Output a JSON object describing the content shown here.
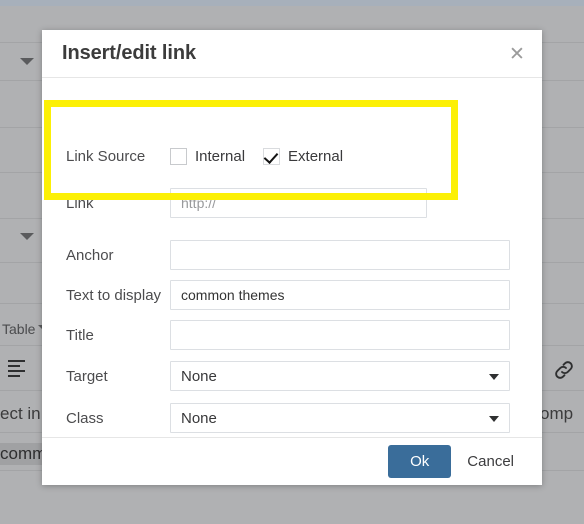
{
  "background": {
    "toolbar_items": [
      {
        "label": "Table",
        "icon": "caret-down-icon"
      }
    ],
    "align_icon": "align-left-icon",
    "link_icon": "link-icon",
    "content_text_left": "ect in",
    "content_text_right": "omp",
    "content_highlighted": "comm",
    "caret_icon": "caret-down-icon"
  },
  "modal": {
    "title": "Insert/edit link",
    "close_icon": "close-icon",
    "highlight_color": "#fcf005",
    "accent_color": "#3a6d9a",
    "fields": {
      "link_source": {
        "label": "Link Source",
        "options": [
          {
            "label": "Internal",
            "checked": false
          },
          {
            "label": "External",
            "checked": true
          }
        ]
      },
      "link": {
        "label": "Link",
        "value": "",
        "placeholder": "http://"
      },
      "anchor": {
        "label": "Anchor",
        "value": "",
        "placeholder": ""
      },
      "text_to_display": {
        "label": "Text to display",
        "value": "common themes",
        "placeholder": ""
      },
      "title": {
        "label": "Title",
        "value": "",
        "placeholder": ""
      },
      "target": {
        "label": "Target",
        "value": "None",
        "caret_icon": "caret-down-icon"
      },
      "class": {
        "label": "Class",
        "value": "None",
        "caret_icon": "caret-down-icon"
      }
    },
    "footer": {
      "ok_label": "Ok",
      "cancel_label": "Cancel"
    }
  }
}
